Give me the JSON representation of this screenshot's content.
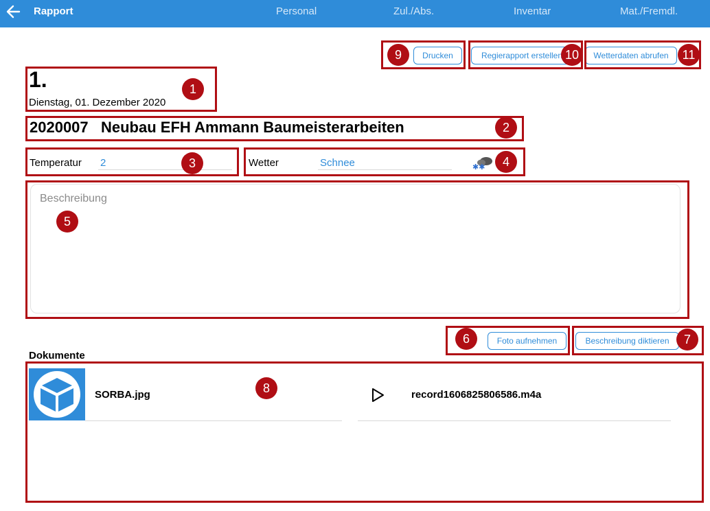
{
  "header": {
    "title": "Rapport",
    "tabs": [
      "Personal",
      "Zul./Abs.",
      "Inventar",
      "Mat./Fremdl."
    ]
  },
  "toolbar": {
    "print_label": "Drucken",
    "regie_label": "Regierapport erstellen",
    "weather_label": "Wetterdaten abrufen"
  },
  "report": {
    "number": "1.",
    "date": "Dienstag, 01. Dezember 2020",
    "project": "2020007   Neubau EFH Ammann Baumeisterarbeiten",
    "temperature_label": "Temperatur",
    "temperature_value": "2",
    "weather_label": "Wetter",
    "weather_value": "Schnee",
    "description_placeholder": "Beschreibung"
  },
  "actions": {
    "photo_label": "Foto aufnehmen",
    "dictate_label": "Beschreibung diktieren"
  },
  "documents": {
    "heading": "Dokumente",
    "items": [
      {
        "name": "SORBA.jpg",
        "icon": "cube-icon"
      },
      {
        "name": "record1606825806586.m4a",
        "icon": "play-icon"
      }
    ]
  },
  "badges": [
    "1",
    "2",
    "3",
    "4",
    "5",
    "6",
    "7",
    "8",
    "9",
    "10",
    "11"
  ],
  "colors": {
    "accent": "#2f8cd9",
    "highlight": "#b00e14"
  }
}
